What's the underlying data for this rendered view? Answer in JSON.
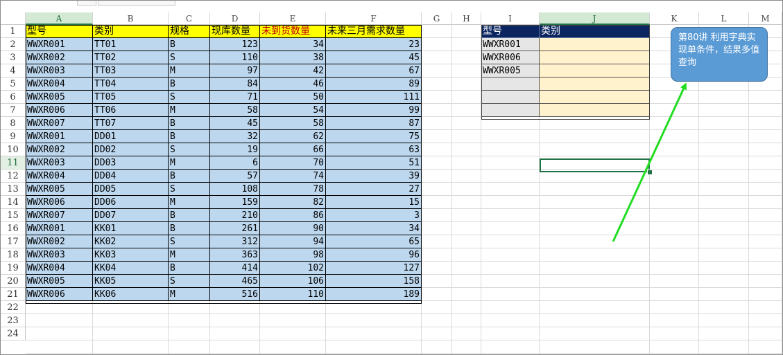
{
  "columns": [
    {
      "letter": "A",
      "active": true
    },
    {
      "letter": "B",
      "active": false
    },
    {
      "letter": "C",
      "active": false
    },
    {
      "letter": "D",
      "active": false
    },
    {
      "letter": "E",
      "active": false
    },
    {
      "letter": "F",
      "active": false
    },
    {
      "letter": "G",
      "active": false
    },
    {
      "letter": "H",
      "active": false
    },
    {
      "letter": "I",
      "active": false
    },
    {
      "letter": "J",
      "active": true
    },
    {
      "letter": "K",
      "active": false
    },
    {
      "letter": "L",
      "active": false
    },
    {
      "letter": "M",
      "active": false
    }
  ],
  "row_numbers": [
    "1",
    "2",
    "3",
    "4",
    "5",
    "6",
    "7",
    "8",
    "9",
    "10",
    "11",
    "12",
    "13",
    "14",
    "15",
    "16",
    "17",
    "18",
    "19",
    "20",
    "21",
    "22",
    "23",
    "24"
  ],
  "active_row": "11",
  "main_table": {
    "headers": [
      "型号",
      "类别",
      "规格",
      "现库数量",
      "未到货数量",
      "未来三月需求数量"
    ],
    "rows": [
      [
        "WWXR001",
        "TT01",
        "B",
        "123",
        "34",
        "23"
      ],
      [
        "WWXR002",
        "TT02",
        "S",
        "110",
        "38",
        "45"
      ],
      [
        "WWXR003",
        "TT03",
        "M",
        "97",
        "42",
        "67"
      ],
      [
        "WWXR004",
        "TT04",
        "B",
        "84",
        "46",
        "89"
      ],
      [
        "WWXR005",
        "TT05",
        "S",
        "71",
        "50",
        "111"
      ],
      [
        "WWXR006",
        "TT06",
        "M",
        "58",
        "54",
        "99"
      ],
      [
        "WWXR007",
        "TT07",
        "B",
        "45",
        "58",
        "87"
      ],
      [
        "WWXR001",
        "DD01",
        "B",
        "32",
        "62",
        "75"
      ],
      [
        "WWXR002",
        "DD02",
        "S",
        "19",
        "66",
        "63"
      ],
      [
        "WWXR003",
        "DD03",
        "M",
        "6",
        "70",
        "51"
      ],
      [
        "WWXR004",
        "DD04",
        "B",
        "57",
        "74",
        "39"
      ],
      [
        "WWXR005",
        "DD05",
        "S",
        "108",
        "78",
        "27"
      ],
      [
        "WWXR006",
        "DD06",
        "M",
        "159",
        "82",
        "15"
      ],
      [
        "WWXR007",
        "DD07",
        "B",
        "210",
        "86",
        "3"
      ],
      [
        "WWXR001",
        "KK01",
        "B",
        "261",
        "90",
        "34"
      ],
      [
        "WWXR002",
        "KK02",
        "S",
        "312",
        "94",
        "65"
      ],
      [
        "WWXR003",
        "KK03",
        "M",
        "363",
        "98",
        "96"
      ],
      [
        "WWXR004",
        "KK04",
        "B",
        "414",
        "102",
        "127"
      ],
      [
        "WWXR005",
        "KK05",
        "S",
        "465",
        "106",
        "158"
      ],
      [
        "WWXR006",
        "KK06",
        "M",
        "516",
        "110",
        "189"
      ]
    ]
  },
  "lookup_table": {
    "headers": [
      "型号",
      "类别"
    ],
    "rows": [
      [
        "WWXR001",
        ""
      ],
      [
        "WWXR006",
        ""
      ],
      [
        "WWXR005",
        ""
      ],
      [
        "",
        ""
      ],
      [
        "",
        ""
      ],
      [
        "",
        ""
      ]
    ]
  },
  "callout": {
    "text": "第80讲 利用字典实现单条件，结果多值查询"
  },
  "colors": {
    "header_yellow": "#ffff00",
    "header_orange_text": "#c00000",
    "data_blue": "#bdd7ee",
    "lookup_header": "#0a2560",
    "lookup_input": "#e7e6e6",
    "lookup_output": "#fff2cc",
    "callout": "#5b9bd5",
    "arrow": "#22dd22",
    "selection": "#217346"
  }
}
